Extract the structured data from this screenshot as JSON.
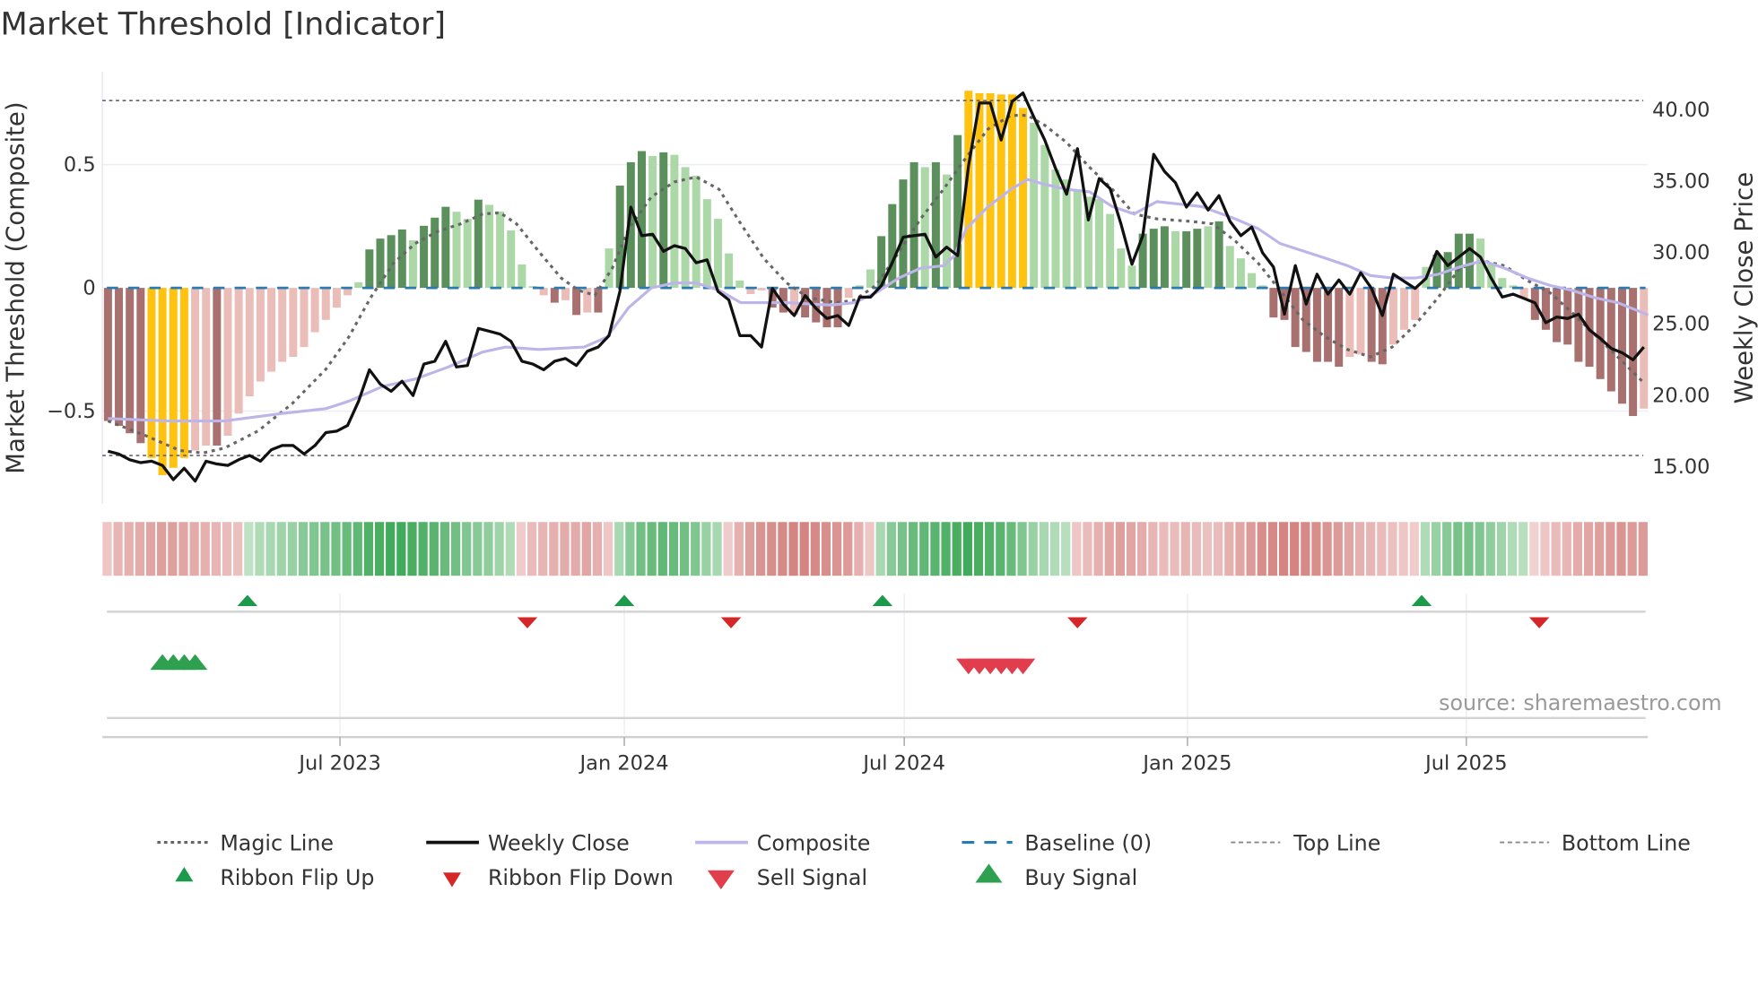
{
  "chart_data": {
    "type": "bar",
    "title": "Market Threshold [Indicator]",
    "ylabel_left": "Market Threshold (Composite)",
    "ylabel_right": "Weekly Close Price",
    "source": "source: sharemaestro.com",
    "left_axis": {
      "ylim": [
        -0.85,
        0.87
      ],
      "ticks": [
        {
          "v": 0.5,
          "label": "0.5"
        },
        {
          "v": 0,
          "label": "0"
        },
        {
          "v": -0.5,
          "label": "−0.5"
        }
      ]
    },
    "right_axis": {
      "ylim": [
        12.5,
        43
      ],
      "ticks": [
        {
          "v": 40,
          "label": "40.00"
        },
        {
          "v": 35,
          "label": "35.00"
        },
        {
          "v": 30,
          "label": "30.00"
        },
        {
          "v": 25,
          "label": "25.00"
        },
        {
          "v": 20,
          "label": "20.00"
        },
        {
          "v": 15,
          "label": "15.00"
        }
      ]
    },
    "x_axis": {
      "unit": "week index",
      "range": [
        0,
        141
      ],
      "ticks": [
        {
          "w": 21.3,
          "label": "Jul 2023"
        },
        {
          "w": 47.4,
          "label": "Jan 2024"
        },
        {
          "w": 73.1,
          "label": "Jul 2024"
        },
        {
          "w": 99.1,
          "label": "Jan 2025"
        },
        {
          "w": 124.7,
          "label": "Jul 2025"
        }
      ]
    },
    "top_line": 0.76,
    "bottom_line": -0.68,
    "baseline": 0,
    "colors": {
      "dr": "#a8716f",
      "pk": "#ebbdb9",
      "dg": "#5b8f5c",
      "lg": "#acd7a7",
      "y": "#ffc20e",
      "close": "#111111",
      "composite": "#bdb5ea",
      "magic": "#666666",
      "baseline": "#2b7bb0",
      "flip_up": "#1a9a4a",
      "flip_down": "#d62728",
      "buy": "#2ea04f",
      "sell": "#e23d4c"
    },
    "composite_bars": {
      "values": [
        -0.54,
        -0.56,
        -0.59,
        -0.63,
        -0.69,
        -0.76,
        -0.73,
        -0.69,
        -0.66,
        -0.64,
        -0.64,
        -0.6,
        -0.51,
        -0.44,
        -0.38,
        -0.34,
        -0.3,
        -0.28,
        -0.24,
        -0.18,
        -0.13,
        -0.08,
        -0.03,
        0.023,
        0.156,
        0.2,
        0.214,
        0.237,
        0.193,
        0.252,
        0.285,
        0.329,
        0.309,
        0.28,
        0.358,
        0.337,
        0.31,
        0.233,
        0.095,
        0.007,
        -0.03,
        -0.06,
        -0.05,
        -0.11,
        -0.1,
        -0.1,
        0.16,
        0.415,
        0.51,
        0.555,
        0.535,
        0.55,
        0.54,
        0.49,
        0.455,
        0.36,
        0.28,
        0.14,
        0.03,
        -0.025,
        -0.01,
        -0.08,
        -0.1,
        -0.11,
        -0.12,
        -0.14,
        -0.16,
        -0.16,
        -0.04,
        0.01,
        0.075,
        0.21,
        0.34,
        0.44,
        0.51,
        0.49,
        0.51,
        0.46,
        0.62,
        0.8,
        0.79,
        0.79,
        0.785,
        0.785,
        0.73,
        0.67,
        0.58,
        0.48,
        0.44,
        0.4,
        0.37,
        0.36,
        0.3,
        0.16,
        0.09,
        0.22,
        0.24,
        0.25,
        0.23,
        0.23,
        0.24,
        0.25,
        0.27,
        0.17,
        0.12,
        0.06,
        0.01,
        -0.12,
        -0.13,
        -0.24,
        -0.26,
        -0.3,
        -0.3,
        -0.32,
        -0.28,
        -0.27,
        -0.3,
        -0.31,
        -0.23,
        -0.17,
        -0.13,
        0.085,
        0.135,
        0.145,
        0.22,
        0.22,
        0.2,
        0.1,
        0.04,
        0.01,
        -0.04,
        -0.13,
        -0.17,
        -0.22,
        -0.23,
        -0.3,
        -0.32,
        -0.37,
        -0.42,
        -0.47,
        -0.52,
        -0.49
      ],
      "classes": [
        "dr",
        "dr",
        "dr",
        "dr",
        "y",
        "y",
        "y",
        "y",
        "pk",
        "pk",
        "dr",
        "pk",
        "pk",
        "pk",
        "pk",
        "pk",
        "pk",
        "pk",
        "pk",
        "pk",
        "pk",
        "pk",
        "pk",
        "lg",
        "dg",
        "dg",
        "dg",
        "dg",
        "lg",
        "dg",
        "dg",
        "dg",
        "lg",
        "lg",
        "dg",
        "lg",
        "lg",
        "lg",
        "lg",
        "lg",
        "pk",
        "dr",
        "pk",
        "dr",
        "pk",
        "dr",
        "lg",
        "dg",
        "dg",
        "dg",
        "lg",
        "dg",
        "lg",
        "lg",
        "lg",
        "lg",
        "lg",
        "lg",
        "lg",
        "pk",
        "pk",
        "dr",
        "dr",
        "pk",
        "dr",
        "dr",
        "dr",
        "dr",
        "pk",
        "lg",
        "lg",
        "dg",
        "dg",
        "dg",
        "dg",
        "lg",
        "dg",
        "lg",
        "dg",
        "y",
        "y",
        "y",
        "y",
        "y",
        "y",
        "lg",
        "lg",
        "lg",
        "lg",
        "lg",
        "lg",
        "lg",
        "lg",
        "lg",
        "lg",
        "dg",
        "dg",
        "dg",
        "lg",
        "dg",
        "dg",
        "lg",
        "dg",
        "lg",
        "lg",
        "lg",
        "lg",
        "dr",
        "dr",
        "dr",
        "dr",
        "dr",
        "dr",
        "dr",
        "pk",
        "pk",
        "dr",
        "dr",
        "pk",
        "pk",
        "pk",
        "lg",
        "dg",
        "dg",
        "dg",
        "dg",
        "lg",
        "lg",
        "lg",
        "lg",
        "pk",
        "dr",
        "dr",
        "dr",
        "dr",
        "dr",
        "dr",
        "dr",
        "dr",
        "dr",
        "dr",
        "pk"
      ]
    },
    "weekly_close": [
      16.0,
      15.8,
      15.4,
      15.2,
      15.3,
      15.0,
      14.0,
      14.8,
      13.9,
      15.3,
      15.1,
      15.0,
      15.4,
      15.7,
      15.3,
      16.1,
      16.4,
      16.4,
      15.8,
      16.4,
      17.3,
      17.4,
      17.8,
      19.5,
      21.7,
      20.7,
      20.2,
      20.9,
      19.9,
      22.1,
      22.3,
      23.7,
      21.9,
      22.0,
      24.6,
      24.4,
      24.2,
      23.7,
      22.3,
      22.1,
      21.7,
      22.3,
      22.5,
      22.0,
      23.0,
      23.3,
      24.1,
      27.2,
      33.1,
      31.1,
      31.2,
      30.0,
      30.4,
      30.2,
      29.2,
      29.4,
      27.2,
      26.6,
      24.1,
      24.1,
      23.3,
      27.4,
      26.3,
      25.5,
      26.9,
      26.0,
      25.3,
      25.5,
      24.8,
      26.8,
      26.8,
      27.6,
      29.2,
      31.0,
      31.1,
      31.2,
      29.6,
      30.3,
      29.7,
      36.0,
      40.4,
      40.4,
      37.8,
      40.5,
      41.1,
      39.4,
      37.8,
      35.8,
      34.0,
      37.2,
      32.2,
      35.1,
      34.4,
      31.9,
      29.1,
      31.1,
      36.8,
      35.6,
      34.8,
      33.1,
      34.1,
      32.9,
      33.9,
      32.1,
      31.1,
      31.7,
      29.9,
      28.9,
      25.6,
      29.0,
      26.3,
      28.4,
      27.0,
      28.0,
      27.0,
      28.5,
      27.4,
      25.5,
      28.4,
      27.9,
      27.4,
      28.1,
      30.0,
      29.0,
      29.6,
      30.2,
      29.6,
      28.1,
      26.8,
      27.0,
      26.7,
      26.4,
      25.0,
      25.4,
      25.3,
      25.6,
      24.5,
      23.9,
      23.2,
      22.9,
      22.4,
      23.3
    ],
    "composite_line": [
      [
        0,
        -0.53
      ],
      [
        5.6,
        -0.54
      ],
      [
        10.7,
        -0.54
      ],
      [
        15.9,
        -0.51
      ],
      [
        20,
        -0.49
      ],
      [
        22.1,
        -0.46
      ],
      [
        25.2,
        -0.4
      ],
      [
        28.2,
        -0.37
      ],
      [
        31.3,
        -0.32
      ],
      [
        34.4,
        -0.26
      ],
      [
        36.5,
        -0.24
      ],
      [
        39.6,
        -0.25
      ],
      [
        43.7,
        -0.24
      ],
      [
        45.8,
        -0.2
      ],
      [
        47.8,
        -0.08
      ],
      [
        49.9,
        0.0
      ],
      [
        52,
        0.02
      ],
      [
        54,
        0.02
      ],
      [
        56.1,
        -0.01
      ],
      [
        58.1,
        -0.06
      ],
      [
        62.3,
        -0.06
      ],
      [
        66.4,
        -0.07
      ],
      [
        68.5,
        -0.06
      ],
      [
        70.5,
        -0.02
      ],
      [
        72.6,
        0.04
      ],
      [
        74.6,
        0.08
      ],
      [
        76.7,
        0.09
      ],
      [
        77.7,
        0.13
      ],
      [
        78.8,
        0.24
      ],
      [
        80.8,
        0.33
      ],
      [
        82.9,
        0.4
      ],
      [
        84.4,
        0.44
      ],
      [
        86,
        0.42
      ],
      [
        88,
        0.4
      ],
      [
        90.1,
        0.39
      ],
      [
        92.2,
        0.33
      ],
      [
        94.2,
        0.3
      ],
      [
        96.3,
        0.35
      ],
      [
        98.4,
        0.34
      ],
      [
        100.4,
        0.33
      ],
      [
        103.5,
        0.28
      ],
      [
        105.6,
        0.24
      ],
      [
        107.6,
        0.18
      ],
      [
        109.7,
        0.15
      ],
      [
        111.8,
        0.12
      ],
      [
        113.8,
        0.09
      ],
      [
        115.9,
        0.05
      ],
      [
        117.9,
        0.04
      ],
      [
        120,
        0.04
      ],
      [
        122.1,
        0.055
      ],
      [
        124.1,
        0.085
      ],
      [
        126.2,
        0.11
      ],
      [
        128.2,
        0.08
      ],
      [
        130.3,
        0.04
      ],
      [
        132.4,
        0.01
      ],
      [
        134.4,
        -0.01
      ],
      [
        136.5,
        -0.04
      ],
      [
        138.6,
        -0.06
      ],
      [
        141.4,
        -0.11
      ]
    ],
    "magic_line": [
      [
        0,
        -0.54
      ],
      [
        3.5,
        -0.6
      ],
      [
        6.6,
        -0.66
      ],
      [
        8.7,
        -0.67
      ],
      [
        10.7,
        -0.65
      ],
      [
        13.8,
        -0.58
      ],
      [
        16.9,
        -0.47
      ],
      [
        20,
        -0.33
      ],
      [
        22.1,
        -0.2
      ],
      [
        24.1,
        -0.04
      ],
      [
        26.2,
        0.1
      ],
      [
        28.2,
        0.18
      ],
      [
        30.3,
        0.23
      ],
      [
        32.4,
        0.26
      ],
      [
        34.4,
        0.3
      ],
      [
        36,
        0.305
      ],
      [
        37.5,
        0.26
      ],
      [
        39.6,
        0.145
      ],
      [
        41.6,
        0.04
      ],
      [
        43.2,
        -0.01
      ],
      [
        44.7,
        -0.03
      ],
      [
        46.3,
        0.08
      ],
      [
        47.8,
        0.24
      ],
      [
        49.9,
        0.37
      ],
      [
        52,
        0.43
      ],
      [
        54,
        0.45
      ],
      [
        56.1,
        0.4
      ],
      [
        58.1,
        0.26
      ],
      [
        60.2,
        0.12
      ],
      [
        62.3,
        0.02
      ],
      [
        64.3,
        -0.04
      ],
      [
        66.9,
        -0.06
      ],
      [
        68.5,
        -0.05
      ],
      [
        70.5,
        0.01
      ],
      [
        72.6,
        0.145
      ],
      [
        74.6,
        0.28
      ],
      [
        76.7,
        0.4
      ],
      [
        78.8,
        0.53
      ],
      [
        80.8,
        0.645
      ],
      [
        82.9,
        0.7
      ],
      [
        84.4,
        0.7
      ],
      [
        86,
        0.66
      ],
      [
        88,
        0.59
      ],
      [
        90.1,
        0.49
      ],
      [
        92.2,
        0.4
      ],
      [
        94.2,
        0.3
      ],
      [
        96.3,
        0.28
      ],
      [
        99.4,
        0.27
      ],
      [
        101.4,
        0.26
      ],
      [
        103.5,
        0.19
      ],
      [
        105.6,
        0.1
      ],
      [
        107.6,
        -0.01
      ],
      [
        109.7,
        -0.13
      ],
      [
        111.8,
        -0.2
      ],
      [
        113.8,
        -0.25
      ],
      [
        115.9,
        -0.28
      ],
      [
        117.9,
        -0.24
      ],
      [
        120,
        -0.15
      ],
      [
        122.1,
        -0.04
      ],
      [
        124.1,
        0.08
      ],
      [
        126.2,
        0.11
      ],
      [
        128.2,
        0.09
      ],
      [
        130.3,
        0.03
      ],
      [
        132.4,
        -0.02
      ],
      [
        134.4,
        -0.1
      ],
      [
        136.5,
        -0.19
      ],
      [
        138.6,
        -0.28
      ],
      [
        141.1,
        -0.39
      ]
    ],
    "ribbon": [
      -0.2,
      -0.35,
      -0.4,
      -0.45,
      -0.5,
      -0.55,
      -0.55,
      -0.5,
      -0.45,
      -0.4,
      -0.35,
      -0.3,
      -0.25,
      0.15,
      0.25,
      0.3,
      0.35,
      0.4,
      0.5,
      0.55,
      0.6,
      0.65,
      0.7,
      0.75,
      0.85,
      0.9,
      0.95,
      0.95,
      0.9,
      0.85,
      0.8,
      0.7,
      0.65,
      0.55,
      0.5,
      0.45,
      0.35,
      0.25,
      -0.15,
      -0.3,
      -0.35,
      -0.4,
      -0.45,
      -0.45,
      -0.5,
      -0.4,
      -0.2,
      0.3,
      0.5,
      0.65,
      0.7,
      0.75,
      0.7,
      0.65,
      0.55,
      0.4,
      0.3,
      -0.15,
      -0.4,
      -0.55,
      -0.65,
      -0.7,
      -0.75,
      -0.8,
      -0.8,
      -0.75,
      -0.7,
      -0.65,
      -0.6,
      -0.4,
      -0.2,
      0.3,
      0.5,
      0.6,
      0.7,
      0.75,
      0.8,
      0.85,
      0.9,
      0.95,
      0.9,
      0.85,
      0.8,
      0.7,
      0.55,
      0.4,
      0.3,
      0.25,
      0.2,
      -0.2,
      -0.3,
      -0.4,
      -0.5,
      -0.55,
      -0.5,
      -0.45,
      -0.35,
      -0.3,
      -0.3,
      -0.35,
      -0.3,
      -0.25,
      -0.3,
      -0.4,
      -0.5,
      -0.6,
      -0.7,
      -0.75,
      -0.8,
      -0.8,
      -0.75,
      -0.7,
      -0.65,
      -0.6,
      -0.5,
      -0.4,
      -0.35,
      -0.3,
      -0.25,
      -0.2,
      -0.15,
      0.25,
      0.4,
      0.5,
      0.6,
      0.6,
      0.55,
      0.45,
      0.35,
      0.25,
      0.2,
      -0.1,
      -0.2,
      -0.3,
      -0.35,
      -0.45,
      -0.5,
      -0.55,
      -0.6,
      -0.65,
      -0.6,
      -0.6
    ],
    "ribbon_flip_up": [
      12.8,
      47.4,
      71.1,
      120.6
    ],
    "ribbon_flip_down": [
      38.5,
      57.2,
      89,
      131.4
    ],
    "buy_signals": [
      5,
      6,
      7,
      8
    ],
    "sell_signals": [
      79,
      80,
      81,
      82,
      83,
      84
    ],
    "legend": {
      "position": "bottom",
      "items": [
        {
          "label": "Magic Line",
          "symbol": "dotted-line"
        },
        {
          "label": "Weekly Close",
          "symbol": "solid-line"
        },
        {
          "label": "Composite",
          "symbol": "lavender-line"
        },
        {
          "label": "Baseline (0)",
          "symbol": "dashed-line"
        },
        {
          "label": "Top Line",
          "symbol": "dotted-line"
        },
        {
          "label": "Bottom Line",
          "symbol": "dotted-line"
        },
        {
          "label": "Ribbon Flip Up",
          "symbol": "triangle-up-icon"
        },
        {
          "label": "Ribbon Flip Down",
          "symbol": "triangle-down-icon"
        },
        {
          "label": "Sell Signal",
          "symbol": "triangle-down-icon"
        },
        {
          "label": "Buy Signal",
          "symbol": "triangle-up-icon"
        }
      ]
    }
  }
}
